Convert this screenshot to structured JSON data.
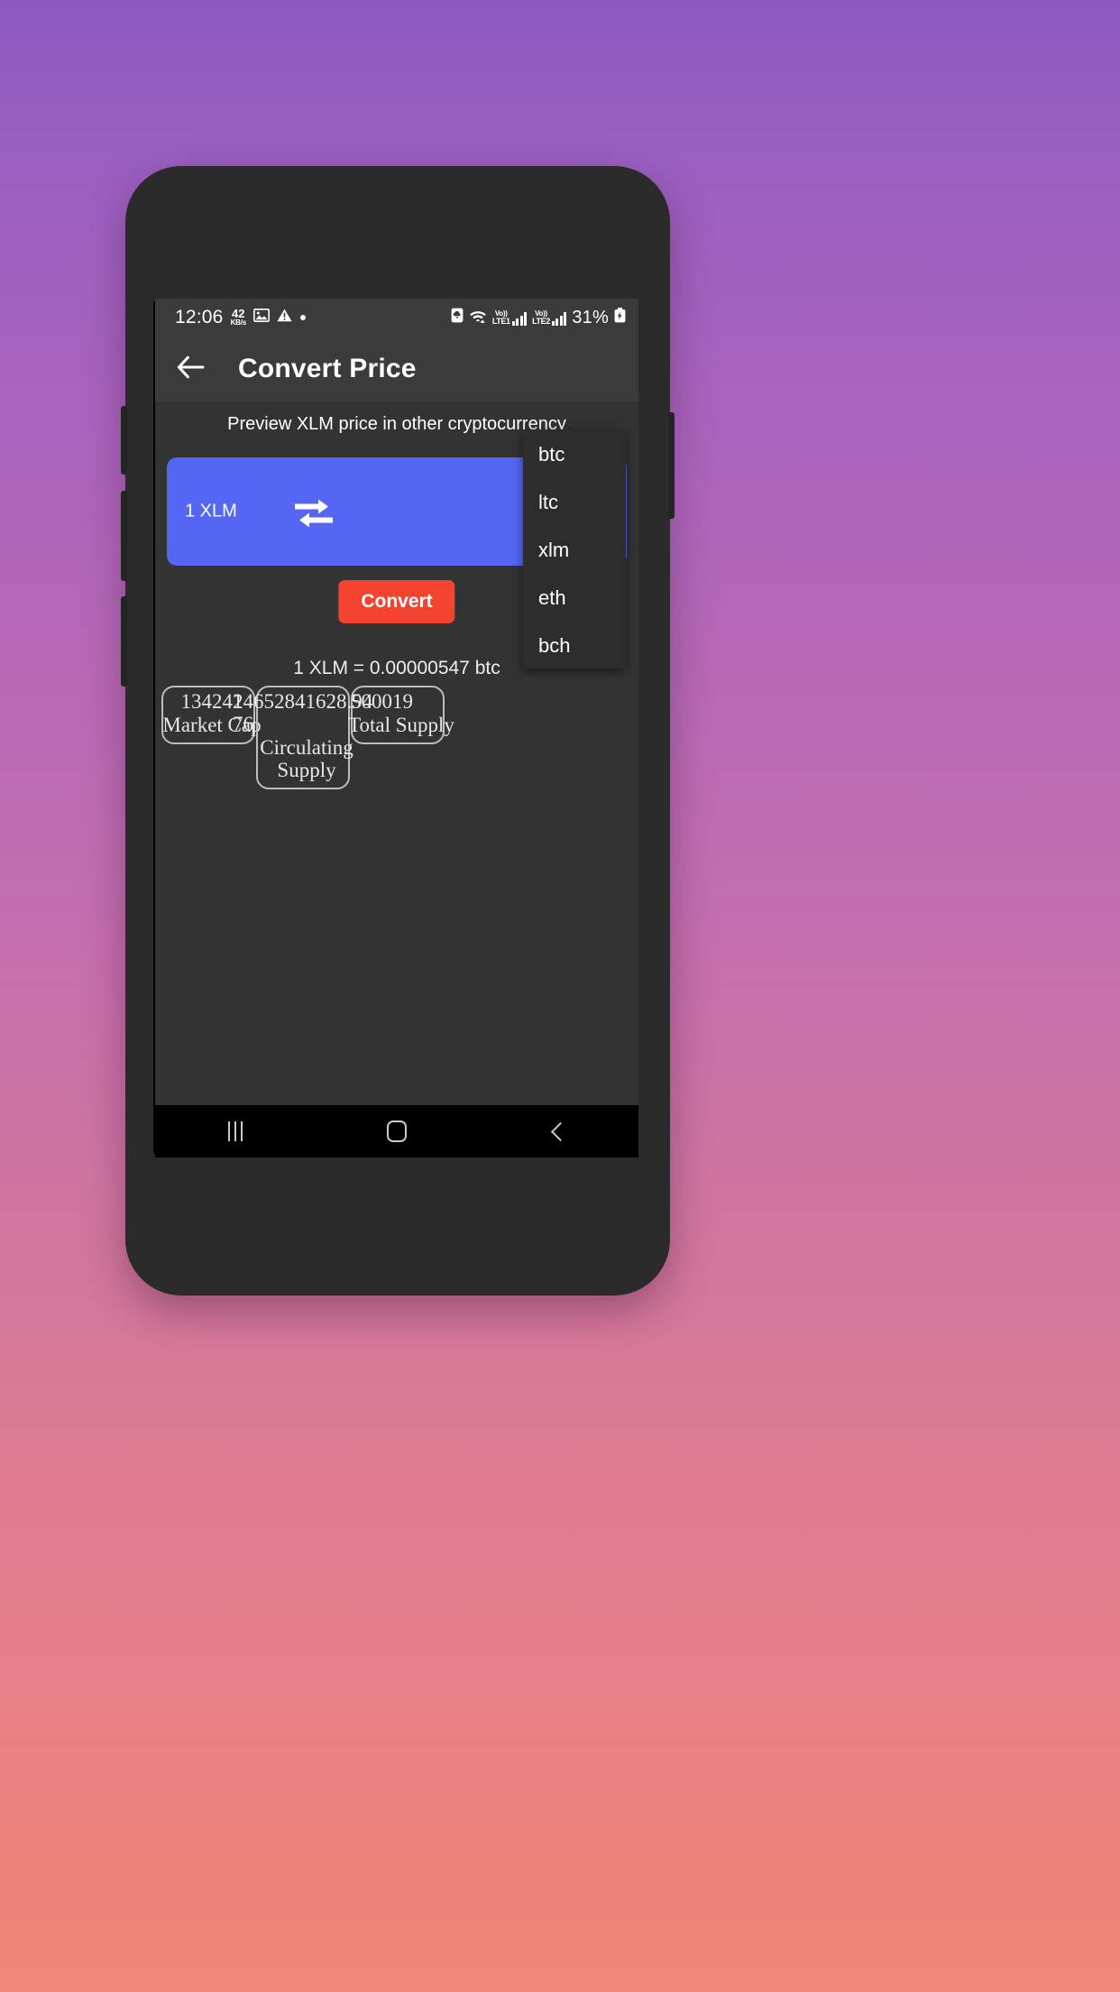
{
  "wallpaper": {
    "gradient_top": "#8a5ac0",
    "gradient_bottom": "#f08678"
  },
  "statusbar": {
    "clock": "12:06",
    "network_speed_value": "42",
    "network_speed_unit": "KB/s",
    "icons_left": [
      "photo-icon",
      "warning-icon",
      "dot-icon"
    ],
    "icons_right": [
      "cloud-backup-icon",
      "wifi-icon",
      "signal-lte1-icon",
      "signal-lte2-icon",
      "battery-charging-icon"
    ],
    "volte1_top": "Vo))",
    "volte1_bottom": "LTE1",
    "volte2_top": "Vo))",
    "volte2_bottom": "LTE2",
    "battery_percent": "31%"
  },
  "appbar": {
    "back_icon": "arrow-left-icon",
    "title": "Convert Price"
  },
  "main": {
    "subtitle": "Preview XLM price in other cryptocurrency",
    "card": {
      "amount": "1 XLM",
      "swap_icon": "swap-horizontal-icon",
      "background_color": "#5566f5"
    },
    "dropdown": {
      "options": [
        {
          "label": "btc"
        },
        {
          "label": "ltc"
        },
        {
          "label": "xlm"
        },
        {
          "label": "eth"
        },
        {
          "label": "bch"
        }
      ]
    },
    "convert_button": {
      "label": "Convert",
      "color": "#f4432f"
    },
    "result": "1 XLM = 0.00000547 btc",
    "stats": [
      {
        "value": "134241",
        "label": "Market Cap"
      },
      {
        "value": "24652841628.9476",
        "label": "Circulating Supply"
      },
      {
        "value": "500019",
        "label": "Total Supply"
      }
    ]
  },
  "navbar": {
    "recents": "recents-icon",
    "home": "home-icon",
    "back": "back-icon"
  }
}
